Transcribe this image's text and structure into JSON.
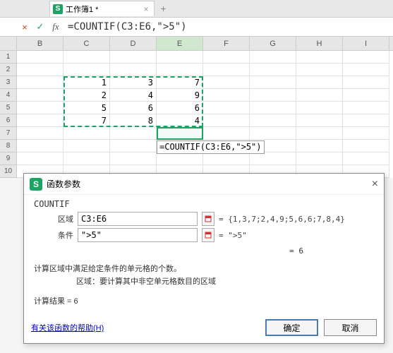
{
  "tab": {
    "title": "工作簿1 *",
    "close": "×",
    "add": "+"
  },
  "formulaBar": {
    "cancel": "×",
    "confirm": "✓",
    "fx": "fx",
    "formula": "=COUNTIF(C3:E6,\">5\")"
  },
  "columns": [
    "B",
    "C",
    "D",
    "E",
    "F",
    "G",
    "H",
    "I"
  ],
  "rows": [
    "1",
    "2",
    "3",
    "4",
    "5",
    "6",
    "7",
    "8",
    "9",
    "10"
  ],
  "cells": {
    "C3": "1",
    "D3": "3",
    "E3": "7",
    "C4": "2",
    "D4": "4",
    "E4": "9",
    "C5": "5",
    "D5": "6",
    "E5": "6",
    "C6": "7",
    "D6": "8",
    "E6": "4"
  },
  "formulaOverlay": "=COUNTIF(C3:E6,\">5\")",
  "dialog": {
    "icon": "S",
    "title": "函数参数",
    "close": "×",
    "fnName": "COUNTIF",
    "args": [
      {
        "label": "区域",
        "value": "C3:E6",
        "eval": "= {1,3,7;2,4,9;5,6,6;7,8,4}"
      },
      {
        "label": "条件",
        "value": "\">5\"",
        "eval": "= \">5\""
      }
    ],
    "evalResult": "= 6",
    "desc1": "计算区域中满足给定条件的单元格的个数。",
    "desc2": "区域：要计算其中非空单元格数目的区域",
    "result": "计算结果 = 6",
    "help": "有关该函数的帮助(H)",
    "ok": "确定",
    "cancel": "取消"
  },
  "chart_data": {
    "type": "table",
    "title": "COUNTIF 区域数据 (C3:E6)",
    "columns": [
      "C",
      "D",
      "E"
    ],
    "rows": [
      [
        1,
        3,
        7
      ],
      [
        2,
        4,
        9
      ],
      [
        5,
        6,
        6
      ],
      [
        7,
        8,
        4
      ]
    ],
    "criteria": ">5",
    "countif_result": 6
  }
}
